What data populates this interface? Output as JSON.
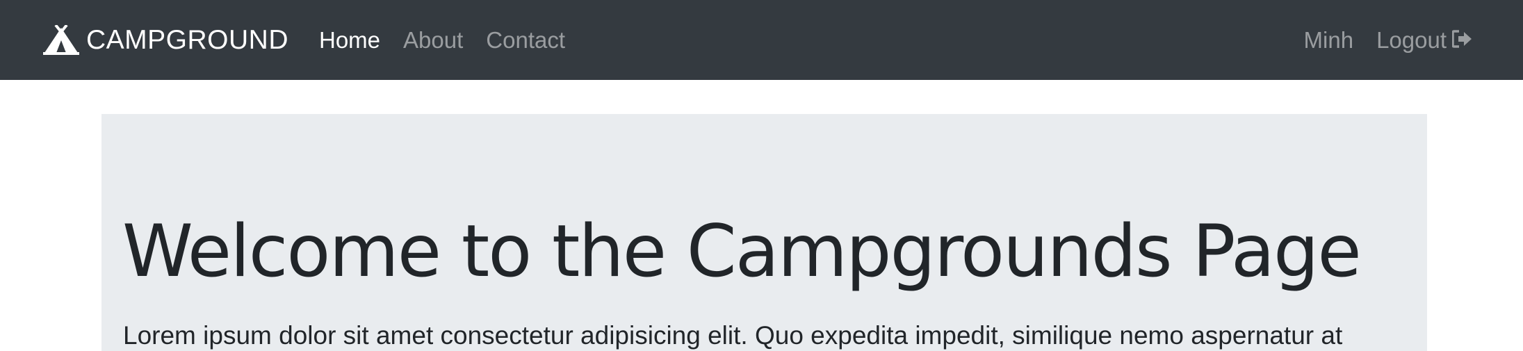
{
  "navbar": {
    "brand": {
      "icon": "tent-icon",
      "label": "CAMPGROUND"
    },
    "links": [
      {
        "label": "Home",
        "active": true
      },
      {
        "label": "About",
        "active": false
      },
      {
        "label": "Contact",
        "active": false
      }
    ],
    "user": {
      "name": "Minh"
    },
    "logout": {
      "label": "Logout",
      "icon": "sign-out-icon"
    }
  },
  "jumbotron": {
    "heading": "Welcome to the Campgrounds Page",
    "lead": "Lorem ipsum dolor sit amet consectetur adipisicing elit. Quo expedita impedit, similique nemo aspernatur at"
  },
  "colors": {
    "navbar_bg": "#343a40",
    "jumbotron_bg": "#e9ecef",
    "text": "#212529"
  }
}
